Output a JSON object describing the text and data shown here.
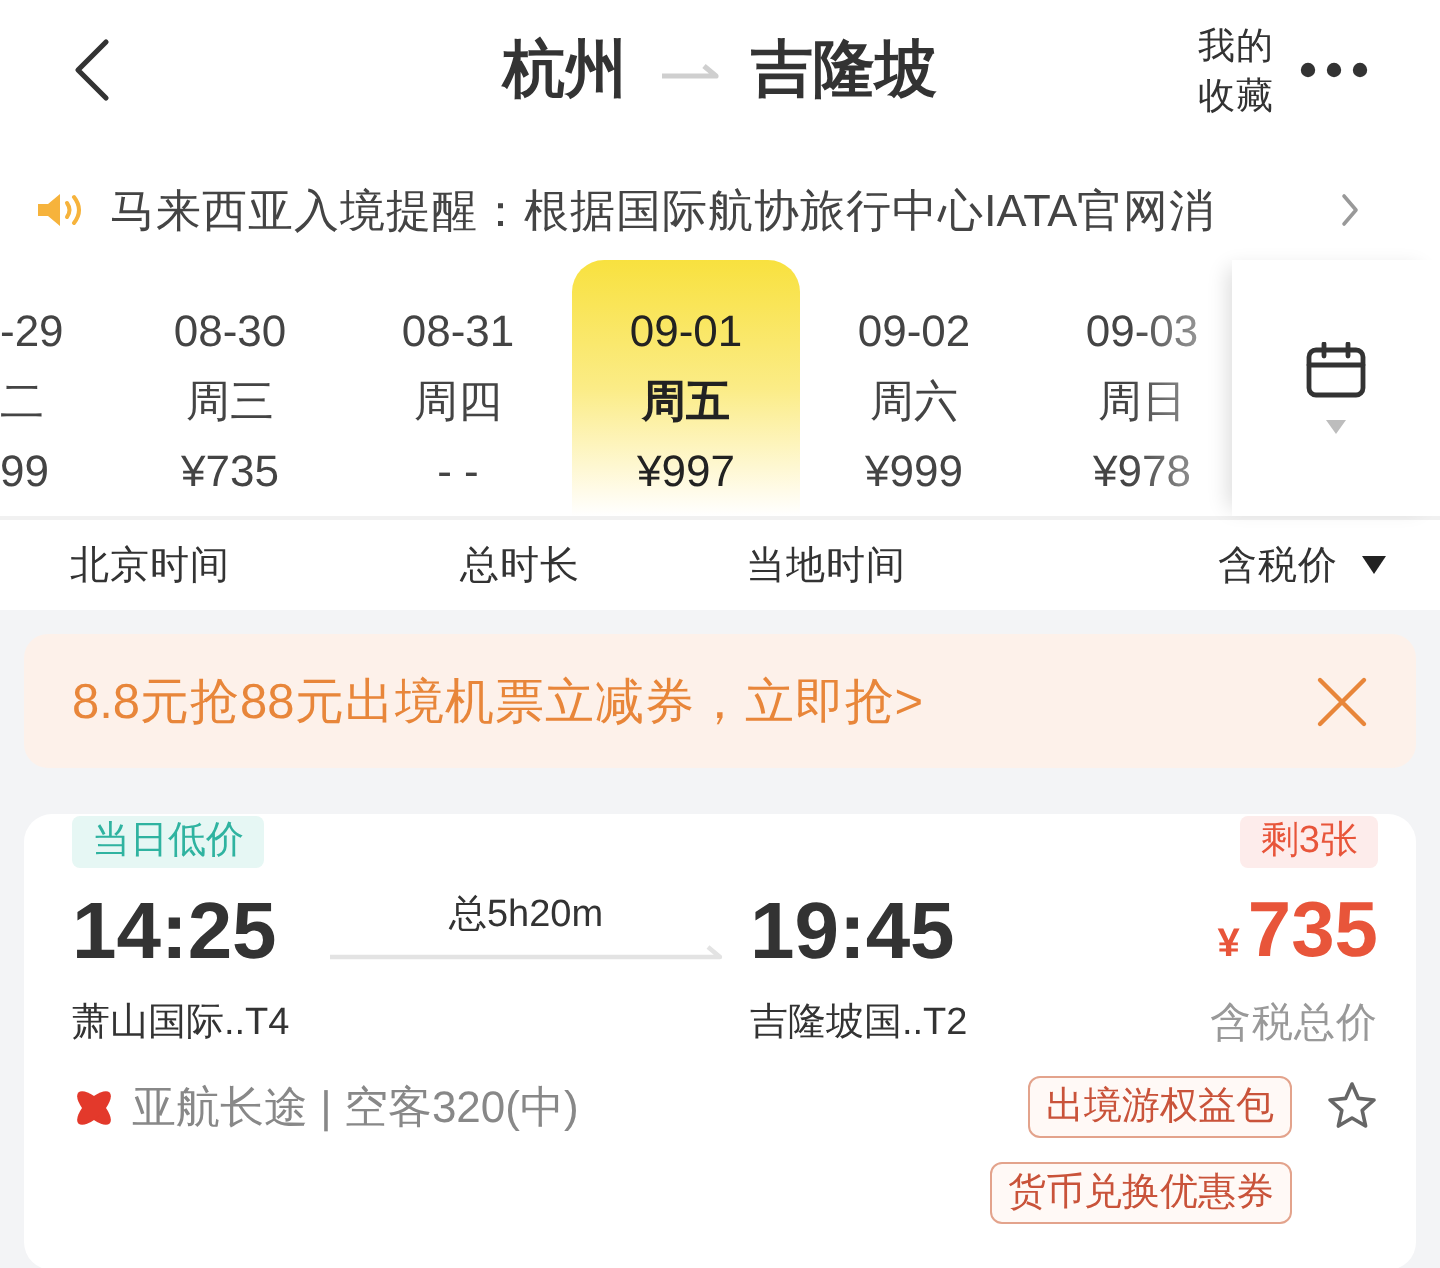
{
  "header": {
    "origin": "杭州",
    "destination": "吉隆坡",
    "favorites": "我的收藏"
  },
  "notice": {
    "text": "马来西亚入境提醒：根据国际航协旅行中心IATA官网消"
  },
  "dates": [
    {
      "date": "-29",
      "weekday": "二",
      "price": "99",
      "selected": false
    },
    {
      "date": "08-30",
      "weekday": "周三",
      "price": "¥735",
      "selected": false
    },
    {
      "date": "08-31",
      "weekday": "周四",
      "price": "- -",
      "selected": false
    },
    {
      "date": "09-01",
      "weekday": "周五",
      "price": "¥997",
      "selected": true
    },
    {
      "date": "09-02",
      "weekday": "周六",
      "price": "¥999",
      "selected": false
    },
    {
      "date": "09-03",
      "weekday": "周日",
      "price": "¥978",
      "selected": false
    }
  ],
  "sort_bar": [
    {
      "label": "北京时间",
      "dropdown": false
    },
    {
      "label": "总时长",
      "dropdown": false
    },
    {
      "label": "当地时间",
      "dropdown": false
    },
    {
      "label": "含税价",
      "dropdown": true
    }
  ],
  "promo": {
    "text": "8.8元抢88元出境机票立减券，立即抢>"
  },
  "flights": [
    {
      "tag": "当日低价",
      "remaining": "剩3张",
      "depart_time": "14:25",
      "duration": "总5h20m",
      "arrive_time": "19:45",
      "currency": "¥",
      "price": "735",
      "depart_airport": "萧山国际..T4",
      "arrive_airport": "吉隆坡国..T2",
      "price_note": "含税总价",
      "airline": "亚航长途 | 空客320(中)",
      "badges": [
        "出境游权益包",
        "货币兑换优惠券"
      ]
    }
  ]
}
